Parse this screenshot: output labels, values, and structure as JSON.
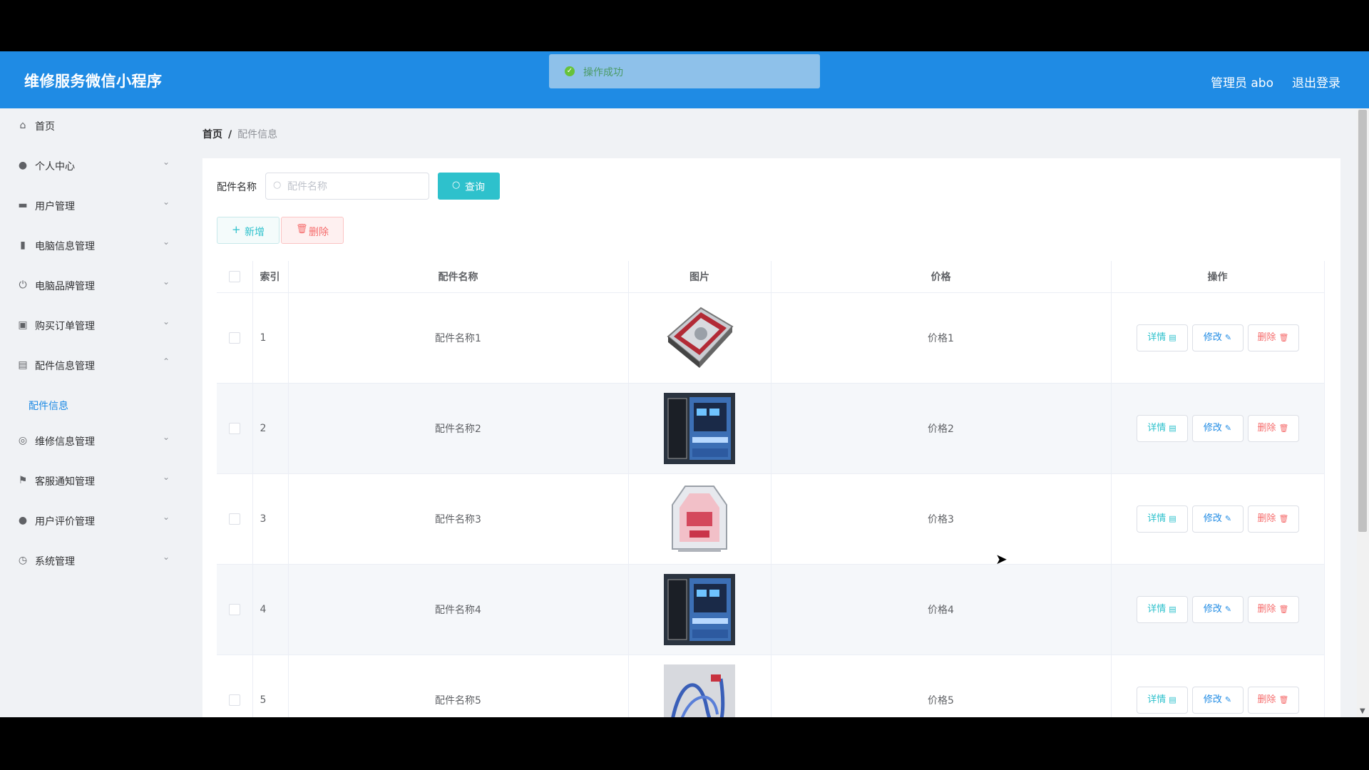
{
  "header": {
    "title": "维修服务微信小程序",
    "user": "管理员 abo",
    "logout": "退出登录"
  },
  "toast": {
    "text": "操作成功",
    "icon": "check-circle-icon",
    "color": "#67c23a"
  },
  "sidebar": {
    "items": [
      {
        "label": "首页",
        "icon": "home-icon",
        "has_arrow": false
      },
      {
        "label": "个人中心",
        "icon": "user-icon",
        "has_arrow": true
      },
      {
        "label": "用户管理",
        "icon": "chat-icon",
        "has_arrow": true
      },
      {
        "label": "电脑信息管理",
        "icon": "bar-chart-icon",
        "has_arrow": true
      },
      {
        "label": "电脑品牌管理",
        "icon": "power-icon",
        "has_arrow": true
      },
      {
        "label": "购买订单管理",
        "icon": "clipboard-icon",
        "has_arrow": true
      },
      {
        "label": "配件信息管理",
        "icon": "document-icon",
        "has_arrow": true,
        "expanded": true
      },
      {
        "label": "维修信息管理",
        "icon": "target-icon",
        "has_arrow": true
      },
      {
        "label": "客服通知管理",
        "icon": "flag-icon",
        "has_arrow": true
      },
      {
        "label": "用户评价管理",
        "icon": "location-icon",
        "has_arrow": true
      },
      {
        "label": "系统管理",
        "icon": "clock-icon",
        "has_arrow": true
      }
    ],
    "sub_item": "配件信息"
  },
  "breadcrumb": {
    "home": "首页",
    "separator": "/",
    "current": "配件信息"
  },
  "search": {
    "label": "配件名称",
    "placeholder": "配件名称",
    "value": "",
    "button": "查询"
  },
  "actions": {
    "add": "新增",
    "delete": "删除"
  },
  "table": {
    "columns": [
      "索引",
      "配件名称",
      "图片",
      "价格",
      "操作"
    ],
    "rows": [
      {
        "index": "1",
        "name": "配件名称1",
        "image": "hard-drive-photo",
        "price": "价格1"
      },
      {
        "index": "2",
        "name": "配件名称2",
        "image": "pc-case-photo",
        "price": "价格2"
      },
      {
        "index": "3",
        "name": "配件名称3",
        "image": "pink-pc-case-photo",
        "price": "价格3"
      },
      {
        "index": "4",
        "name": "配件名称4",
        "image": "pc-case-photo",
        "price": "价格4"
      },
      {
        "index": "5",
        "name": "配件名称5",
        "image": "cable-photo",
        "price": "价格5"
      }
    ],
    "row_actions": {
      "detail": "详情",
      "edit": "修改",
      "delete": "删除"
    }
  },
  "colors": {
    "primary": "#1f8be4",
    "accent": "#2ec1cc",
    "danger": "#f56c6c"
  }
}
